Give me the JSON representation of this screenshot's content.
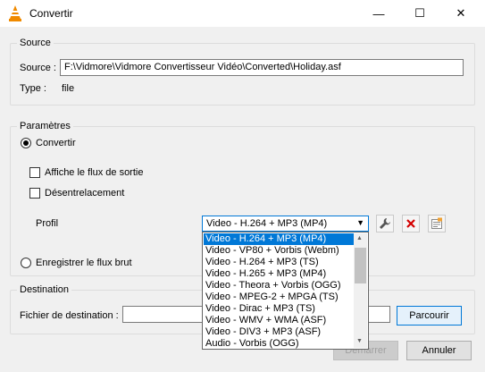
{
  "window": {
    "title": "Convertir"
  },
  "source": {
    "group_title": "Source",
    "source_label": "Source :",
    "source_value": "F:\\Vidmore\\Vidmore Convertisseur Vidéo\\Converted\\Holiday.asf",
    "type_label": "Type :",
    "type_value": "file"
  },
  "params": {
    "group_title": "Paramètres",
    "convert_label": "Convertir",
    "show_output_label": "Affiche le flux de sortie",
    "deinterlace_label": "Désentrelacement",
    "profile_label": "Profil",
    "profile_selected": "Video - H.264 + MP3 (MP4)",
    "dump_label": "Enregistrer le flux brut"
  },
  "profiles": [
    "Video - H.264 + MP3 (MP4)",
    "Video - VP80 + Vorbis (Webm)",
    "Video - H.264 + MP3 (TS)",
    "Video - H.265 + MP3 (MP4)",
    "Video - Theora + Vorbis (OGG)",
    "Video - MPEG-2 + MPGA (TS)",
    "Video - Dirac + MP3 (TS)",
    "Video - WMV + WMA (ASF)",
    "Video - DIV3 + MP3 (ASF)",
    "Audio - Vorbis (OGG)"
  ],
  "destination": {
    "group_title": "Destination",
    "dest_label": "Fichier de destination :",
    "browse_label": "Parcourir"
  },
  "footer": {
    "start_label": "Démarrer",
    "cancel_label": "Annuler"
  },
  "colors": {
    "accent": "#0078d7",
    "delete_red": "#d40000"
  }
}
